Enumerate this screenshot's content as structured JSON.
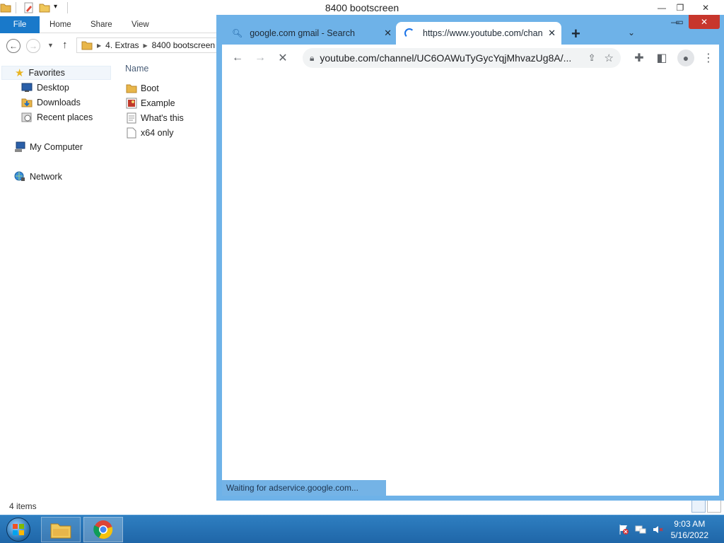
{
  "explorer": {
    "title": "8400 bootscreen",
    "ribbon_tabs": [
      "File",
      "Home",
      "Share",
      "View"
    ],
    "breadcrumb": [
      "4. Extras",
      "8400 bootscreen"
    ],
    "nav": {
      "favorites": "Favorites",
      "desktop": "Desktop",
      "downloads": "Downloads",
      "recent": "Recent places",
      "computer": "My Computer",
      "network": "Network"
    },
    "column_header": "Name",
    "files": [
      {
        "name": "Boot",
        "icon": "folder-icon"
      },
      {
        "name": "Example",
        "icon": "image-file-icon"
      },
      {
        "name": "What's this",
        "icon": "text-file-icon"
      },
      {
        "name": "x64 only",
        "icon": "blank-file-icon"
      }
    ],
    "status": "4 items"
  },
  "chrome": {
    "tabs": [
      {
        "title": "google.com gmail - Search",
        "active": false
      },
      {
        "title": "https://www.youtube.com/chan",
        "active": true
      }
    ],
    "url": "youtube.com/channel/UC6OAWuTyGycYqjMhvazUg8A/...",
    "status": "Waiting for adservice.google.com..."
  },
  "taskbar": {
    "time": "9:03 AM",
    "date": "5/16/2022"
  },
  "colors": {
    "chrome_frame": "#6eb2e8",
    "ribbon_file": "#1979ca",
    "taskbar": "#2571b5"
  }
}
